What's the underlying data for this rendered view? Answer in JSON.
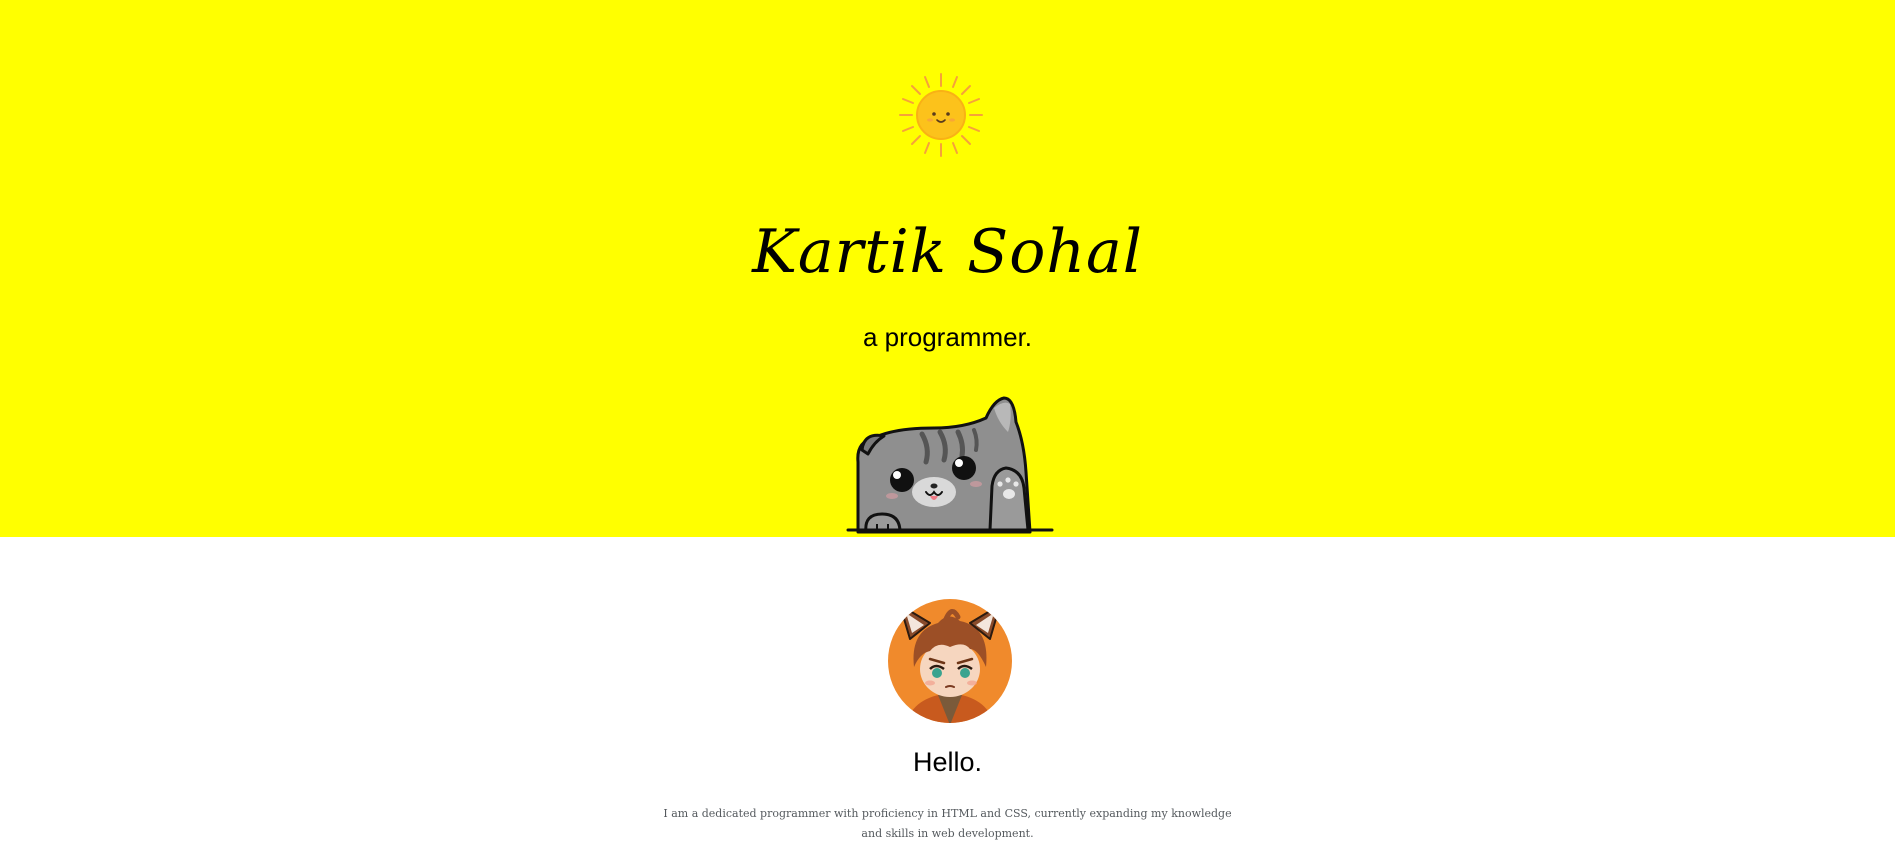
{
  "hero": {
    "background": "#ffff00",
    "sun_icon": "sun-icon",
    "title": "Kartik Sohal",
    "subtitle": "a programmer.",
    "cat_image": "waving-cat-illustration"
  },
  "about": {
    "avatar": "anime-cat-boy-avatar",
    "heading": "Hello.",
    "bio": "I am a dedicated programmer with proficiency in HTML and CSS, currently expanding my knowledge and skills in web development."
  }
}
